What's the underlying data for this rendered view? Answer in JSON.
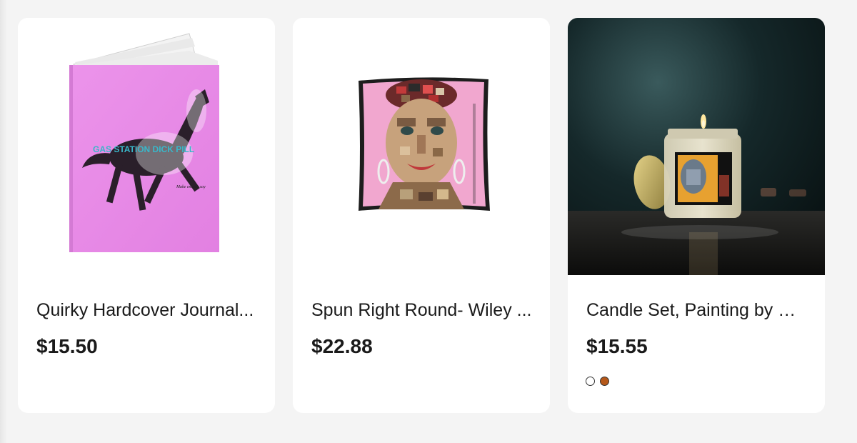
{
  "products": [
    {
      "title": "Quirky Hardcover Journal...",
      "price": "$15.50",
      "cover_text": "GAS STATION DICK PILL",
      "cover_subtext": "Make em say say"
    },
    {
      "title": "Spun Right Round- Wiley ...",
      "price": "$22.88"
    },
    {
      "title": "Candle Set, Painting by W...",
      "price": "$15.55",
      "swatches": [
        {
          "name": "white",
          "color": "#ffffff"
        },
        {
          "name": "amber",
          "color": "#b5581a"
        }
      ]
    }
  ],
  "colors": {
    "page_background": "#f4f4f4",
    "card_background": "#ffffff",
    "journal_cover": "#e98be8",
    "pillow_background": "#f1a7cf"
  }
}
